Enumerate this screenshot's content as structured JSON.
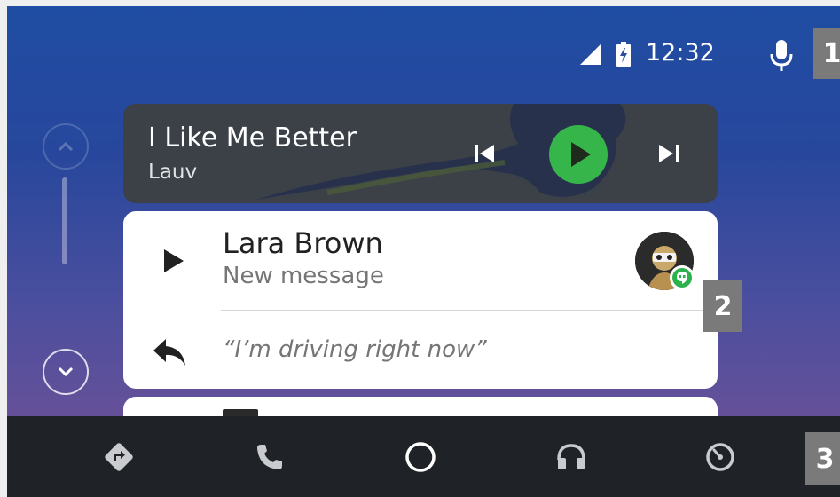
{
  "status": {
    "time": "12:32",
    "signal_icon": "signal-icon",
    "battery_icon": "battery-charging-icon",
    "mic_icon": "microphone-icon"
  },
  "annotations": {
    "badge_1": "1",
    "badge_2": "2",
    "badge_3": "3"
  },
  "media": {
    "title": "I Like Me Better",
    "artist": "Lauv",
    "controls": [
      "skip-previous-icon",
      "play-icon",
      "skip-next-icon"
    ],
    "play_color": "#36b54a"
  },
  "message": {
    "sender": "Lara Brown",
    "subtitle": "New message",
    "reply": "“I’m driving right now”",
    "app_badge_color": "#2bb24c"
  },
  "nav": {
    "items": [
      "navigation-icon",
      "phone-icon",
      "home-icon",
      "headphones-icon",
      "exit-icon"
    ]
  },
  "colors": {
    "background_top": "#1f4da3",
    "background_bottom": "#6b5095",
    "nav_bar": "#1f2226",
    "card": "#ffffff",
    "media_card": "#3c4148"
  }
}
